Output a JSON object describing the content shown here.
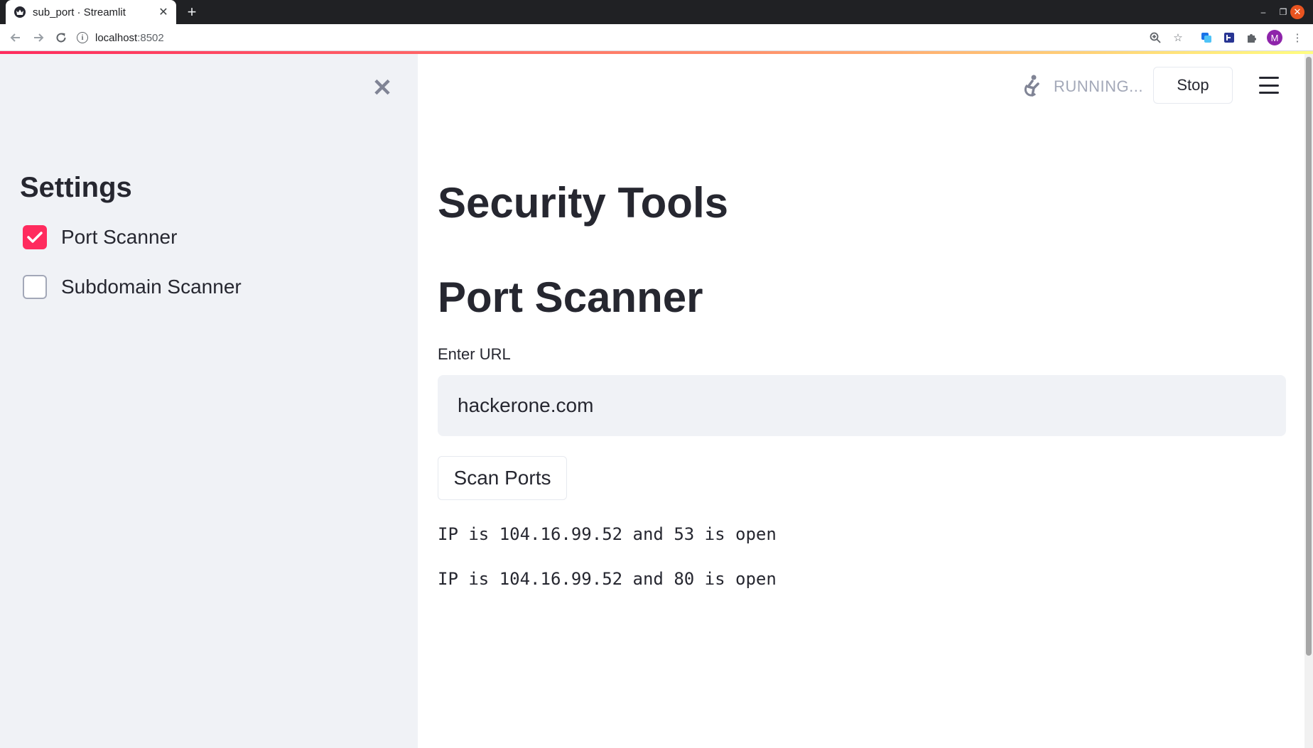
{
  "browser": {
    "tab_title": "sub_port · Streamlit",
    "url_host": "localhost",
    "url_port": ":8502",
    "profile_initial": "M"
  },
  "sidebar": {
    "title": "Settings",
    "options": [
      {
        "label": "Port Scanner",
        "checked": true
      },
      {
        "label": "Subdomain Scanner",
        "checked": false
      }
    ]
  },
  "status": {
    "running_text": "RUNNING...",
    "stop_label": "Stop"
  },
  "main": {
    "title": "Security Tools",
    "section_title": "Port Scanner",
    "url_input": {
      "label": "Enter URL",
      "value": "hackerone.com"
    },
    "scan_button_label": "Scan Ports",
    "results": [
      "IP is 104.16.99.52 and 53 is open",
      "IP is 104.16.99.52 and 80 is open"
    ]
  },
  "colors": {
    "accent": "#ff2b5e",
    "sidebar_bg": "#f0f2f6",
    "text": "#262730",
    "muted": "#a3a8b8"
  },
  "icons": {
    "favicon": "streamlit-crown-icon",
    "running": "person-swimming-icon",
    "menu": "hamburger-menu-icon",
    "sidebar_close": "close-icon"
  }
}
